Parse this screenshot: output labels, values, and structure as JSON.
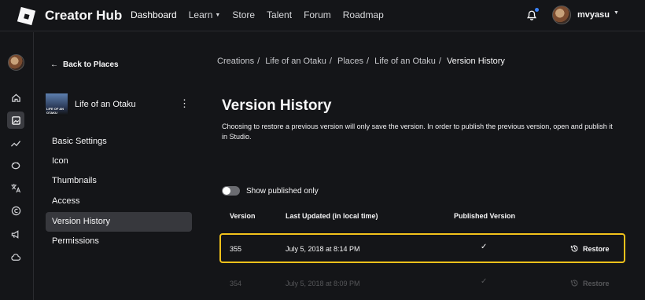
{
  "app": {
    "brand": "Creator Hub",
    "nav": [
      {
        "label": "Dashboard",
        "active": true
      },
      {
        "label": "Learn",
        "has_dropdown": true
      },
      {
        "label": "Store"
      },
      {
        "label": "Talent"
      },
      {
        "label": "Forum"
      },
      {
        "label": "Roadmap"
      }
    ],
    "username": "mvyasu",
    "notification_dot_color": "#3b82f6"
  },
  "rail": {
    "icons": [
      "home-icon",
      "creations-icon",
      "analytics-icon",
      "monetization-icon",
      "translate-icon",
      "copyright-icon",
      "ads-icon",
      "cloud-icon"
    ],
    "active_icon": "creations-icon"
  },
  "sidebar": {
    "back_label": "Back to Places",
    "place": {
      "name": "Life of an Otaku",
      "thumbnail_caption": "LIFE OF AN OTAKU"
    },
    "items": [
      {
        "label": "Basic Settings"
      },
      {
        "label": "Icon"
      },
      {
        "label": "Thumbnails"
      },
      {
        "label": "Access"
      },
      {
        "label": "Version History",
        "active": true
      },
      {
        "label": "Permissions"
      }
    ]
  },
  "main": {
    "breadcrumb": [
      "Creations",
      "Life of an Otaku",
      "Places",
      "Life of an Otaku",
      "Version History"
    ],
    "title": "Version History",
    "description": "Choosing to restore a previous version will only save the version. In order to publish the previous version, open and publish it in Studio.",
    "toggle": {
      "label": "Show published only",
      "on": false
    },
    "table": {
      "headers": [
        "Version",
        "Last Updated (in local time)",
        "Published Version"
      ],
      "rows": [
        {
          "version": "355",
          "updated": "July 5, 2018 at 8:14 PM",
          "published": true,
          "action": "Restore",
          "highlighted": true
        },
        {
          "version": "354",
          "updated": "July 5, 2018 at 8:09 PM",
          "published": true,
          "action": "Restore",
          "highlighted": false
        }
      ]
    },
    "highlight_color": "#f2c21b"
  }
}
